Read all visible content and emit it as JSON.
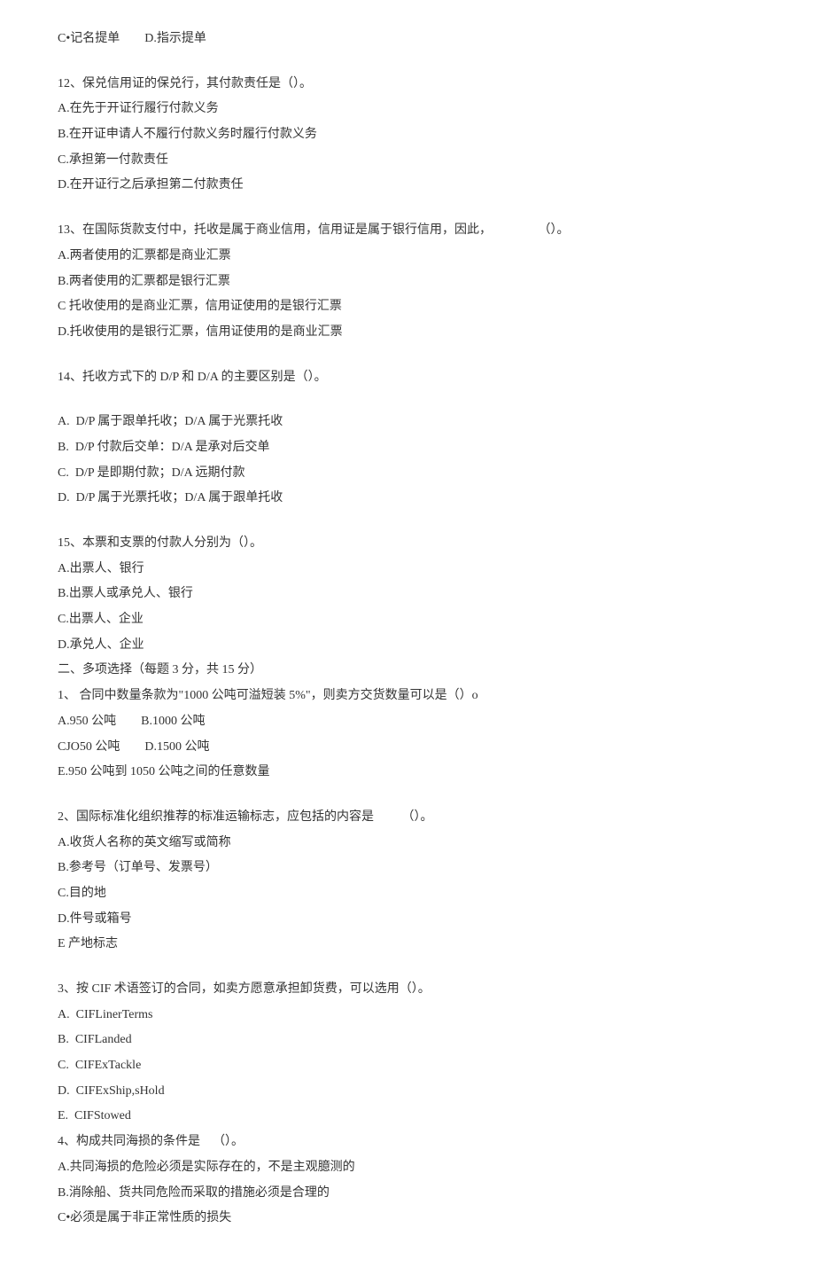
{
  "q11_opts_cd": "C•记名提单        D.指示提单",
  "q12": {
    "stem": "12、保兑信用证的保兑行，其付款责任是（）。",
    "a": "A.在先于开证行履行付款义务",
    "b": "B.在开证申请人不履行付款义务时履行付款义务",
    "c": "C.承担第一付款责任",
    "d": "D.在开证行之后承担第二付款责任"
  },
  "q13": {
    "stem": "13、在国际货款支付中，托收是属于商业信用，信用证是属于银行信用，因此，               （）。",
    "a": "A.两者使用的汇票都是商业汇票",
    "b": "B.两者使用的汇票都是银行汇票",
    "c": "C 托收使用的是商业汇票，信用证使用的是银行汇票",
    "d": "D.托收使用的是银行汇票，信用证使用的是商业汇票"
  },
  "q14": {
    "stem": "14、托收方式下的 D/P 和 D/A 的主要区别是（）。",
    "a": "A.  D/P 属于跟单托收；D/A 属于光票托收",
    "b": "B.  D/P 付款后交单：D/A 是承对后交单",
    "c": "C.  D/P 是即期付款；D/A 远期付款",
    "d": "D.  D/P 属于光票托收；D/A 属于跟单托收"
  },
  "q15": {
    "stem": "15、本票和支票的付款人分别为（）。",
    "a": "A.出票人、银行",
    "b": "B.出票人或承兑人、银行",
    "c": "C.出票人、企业",
    "d": "D.承兑人、企业"
  },
  "section2_title": "二、多项选择（每题 3 分，共 15 分）",
  "m1": {
    "stem": "1、 合同中数量条款为\"1000 公吨可溢短装 5%\"，则卖方交货数量可以是（）o",
    "ab": "A.950 公吨        B.1000 公吨",
    "cd": "CJO50 公吨        D.1500 公吨",
    "e": "E.950 公吨到 1050 公吨之间的任意数量"
  },
  "m2": {
    "stem": "2、国际标准化组织推荐的标准运输标志，应包括的内容是         （）。",
    "a": "A.收货人名称的英文缩写或简称",
    "b": "B.参考号（订单号、发票号）",
    "c": "C.目的地",
    "d": "D.件号或箱号",
    "e": "E 产地标志"
  },
  "m3": {
    "stem": "3、按 CIF 术语签订的合同，如卖方愿意承担卸货费，可以选用（）。",
    "a": "A.  CIFLinerTerms",
    "b": "B.  CIFLanded",
    "c": "C.  CIFExTackle",
    "d": "D.  CIFExShip,sHold",
    "e": "E.  CIFStowed"
  },
  "m4": {
    "stem": "4、构成共同海损的条件是    （）。",
    "a": "A.共同海损的危险必须是实际存在的，不是主观臆测的",
    "b": "B.消除船、货共同危险而采取的措施必须是合理的",
    "c": "C•必须是属于非正常性质的损失"
  }
}
